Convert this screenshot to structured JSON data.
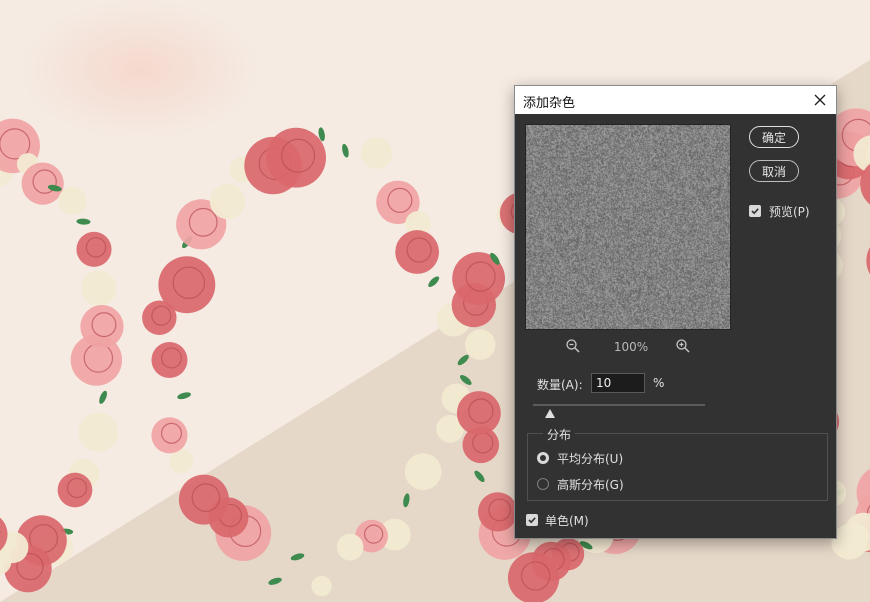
{
  "dialog": {
    "title": "添加杂色",
    "ok_label": "确定",
    "cancel_label": "取消",
    "preview_label": "预览(P)",
    "preview_checked": true,
    "zoom_value": "100%",
    "amount_label": "数量(A):",
    "amount_value": "10",
    "amount_unit": "%",
    "amount_fraction": 0.1,
    "distribution_title": "分布",
    "distribution_options": [
      {
        "label": "平均分布(U)",
        "selected": true
      },
      {
        "label": "高斯分布(G)",
        "selected": false
      }
    ],
    "monochrome_label": "单色(M)",
    "monochrome_checked": true
  },
  "colors": {
    "background": "#f5ebe3",
    "background_lower": "#e6d8c8",
    "rose": "#d9676b",
    "rose_light": "#f0a4a4",
    "leaf": "#3f8a4e",
    "blossom": "#f2ead2",
    "dialog_body": "#323232",
    "title_bar": "#ffffff"
  }
}
